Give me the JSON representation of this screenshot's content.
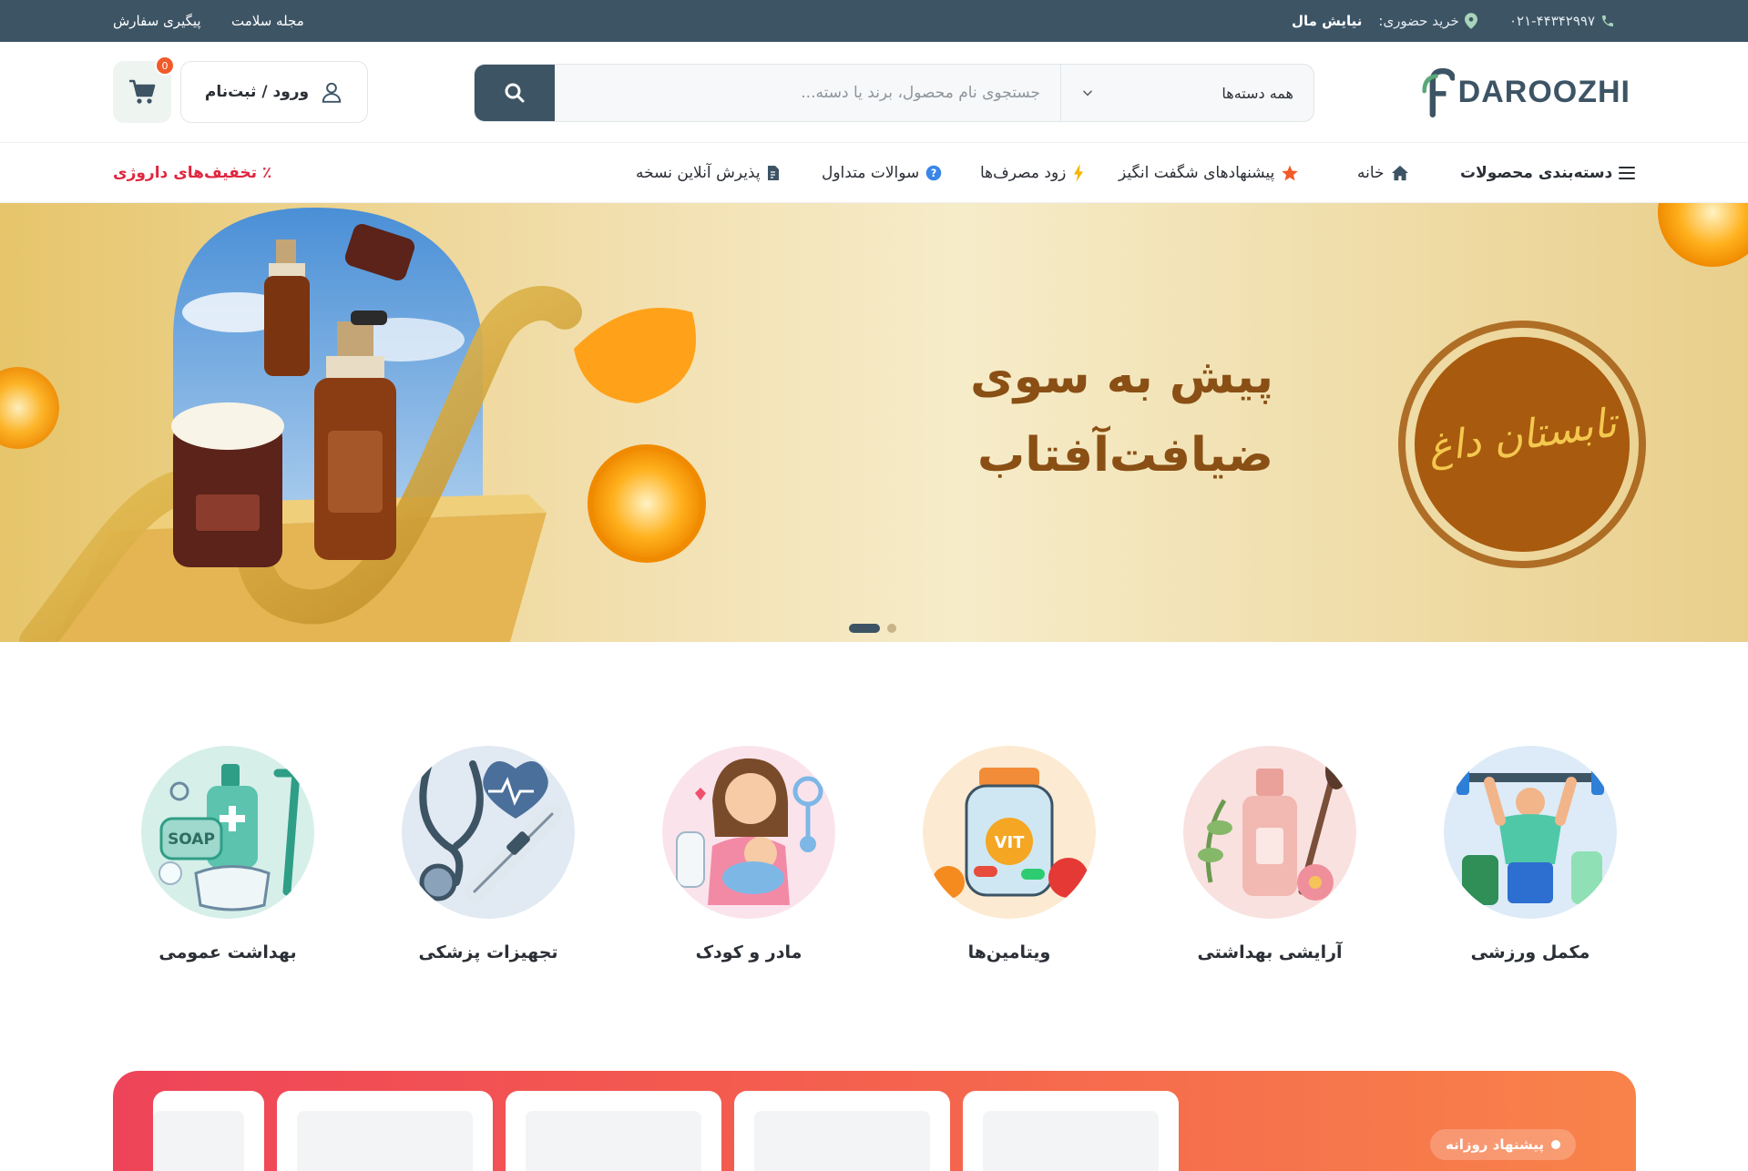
{
  "topbar": {
    "phone": "۰۲۱-۴۴۳۴۲۹۹۷",
    "store_label": "خرید حضوری:",
    "store_name": "نیایش مال",
    "links": [
      "مجله سلامت",
      "پیگیری سفارش"
    ]
  },
  "header": {
    "logo_text": "DAROOZHI",
    "search": {
      "category": "همه دسته‌ها",
      "placeholder": "جستجوی نام محصول، برند یا دسته..."
    },
    "login_label": "ورود / ثبت‌نام",
    "cart_count": "0"
  },
  "nav": {
    "categories_label": "دسته‌بندی محصولات",
    "items": [
      "خانه",
      "پیشنهادهای شگفت انگیز",
      "زود مصرف‌ها",
      "سوالات متداول",
      "پذیرش آنلاین نسخه"
    ],
    "discount_label": "٪ تخفیف‌های داروژی"
  },
  "banner": {
    "title_line1": "پیش به سوی",
    "title_line2": "ضیافت‌آفتاب",
    "seal_text": "تابستان داغ",
    "slides": 2,
    "active_slide": 1
  },
  "categories": [
    {
      "label": "مکمل ورزشی",
      "icon": "fitness-icon"
    },
    {
      "label": "آرایشی بهداشتی",
      "icon": "cosmetics-icon"
    },
    {
      "label": "ویتامین‌ها",
      "icon": "vitamins-icon"
    },
    {
      "label": "مادر و کودک",
      "icon": "mother-baby-icon"
    },
    {
      "label": "تجهیزات پزشکی",
      "icon": "medical-equipment-icon"
    },
    {
      "label": "بهداشت عمومی",
      "icon": "hygiene-icon"
    }
  ],
  "daily_offer": {
    "label": "پیشنهاد روزانه"
  },
  "colors": {
    "primary": "#3d5465",
    "accent": "#f15a29",
    "discount": "#e0263f",
    "banner_text": "#8a4f14"
  }
}
